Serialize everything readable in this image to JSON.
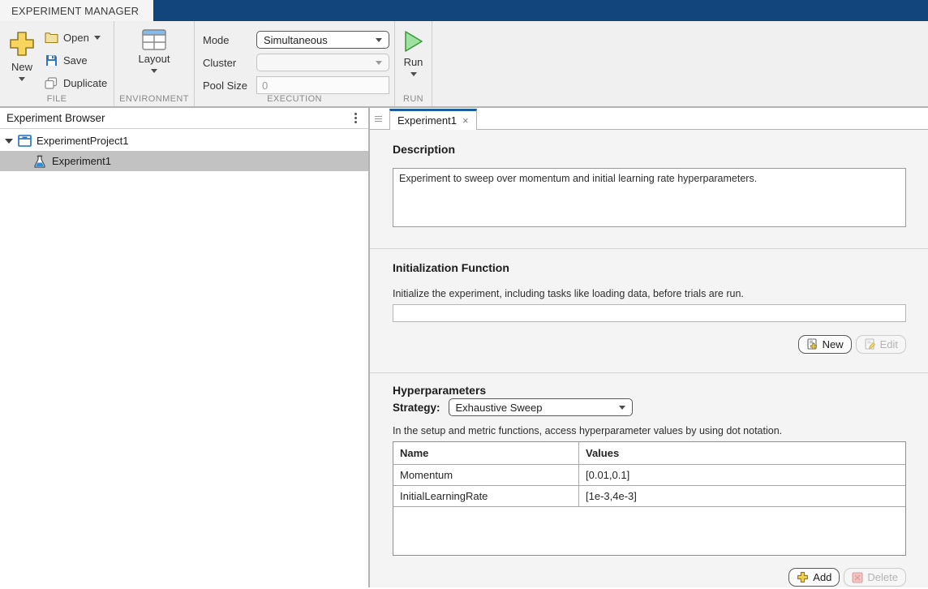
{
  "app": {
    "tab_label": "EXPERIMENT MANAGER"
  },
  "toolbar": {
    "file": {
      "section_label": "FILE",
      "new_label": "New",
      "open_label": "Open",
      "save_label": "Save",
      "duplicate_label": "Duplicate"
    },
    "environment": {
      "section_label": "ENVIRONMENT",
      "layout_label": "Layout"
    },
    "execution": {
      "section_label": "EXECUTION",
      "mode_label": "Mode",
      "mode_value": "Simultaneous",
      "cluster_label": "Cluster",
      "cluster_value": "",
      "pool_size_label": "Pool Size",
      "pool_size_value": "0"
    },
    "run": {
      "section_label": "RUN",
      "run_label": "Run"
    }
  },
  "browser": {
    "title": "Experiment Browser",
    "project_label": "ExperimentProject1",
    "experiment_label": "Experiment1"
  },
  "main": {
    "tab_label": "Experiment1",
    "close_glyph": "×",
    "description": {
      "heading": "Description",
      "text": "Experiment to sweep over momentum and initial learning rate hyperparameters."
    },
    "initialization": {
      "heading": "Initialization Function",
      "hint": "Initialize the experiment, including tasks like loading data, before trials are run.",
      "value": "",
      "new_label": "New",
      "edit_label": "Edit"
    },
    "hyperparameters": {
      "heading": "Hyperparameters",
      "strategy_label": "Strategy:",
      "strategy_value": "Exhaustive Sweep",
      "hint": "In the setup and metric functions, access hyperparameter values by using dot notation.",
      "table": {
        "headers": [
          "Name",
          "Values"
        ],
        "rows": [
          [
            "Momentum",
            "[0.01,0.1]"
          ],
          [
            "InitialLearningRate",
            "[1e-3,4e-3]"
          ]
        ]
      },
      "add_label": "Add",
      "delete_label": "Delete"
    }
  },
  "colors": {
    "banner_blue": "#11457c",
    "tab_accent_blue": "#1c5d9c",
    "selection_gray": "#c2c2c2",
    "icon_yellow": "#f7d55e",
    "run_green": "#9fe29f",
    "delete_pink": "#f2c4c4",
    "save_blue": "#2e75c6"
  }
}
